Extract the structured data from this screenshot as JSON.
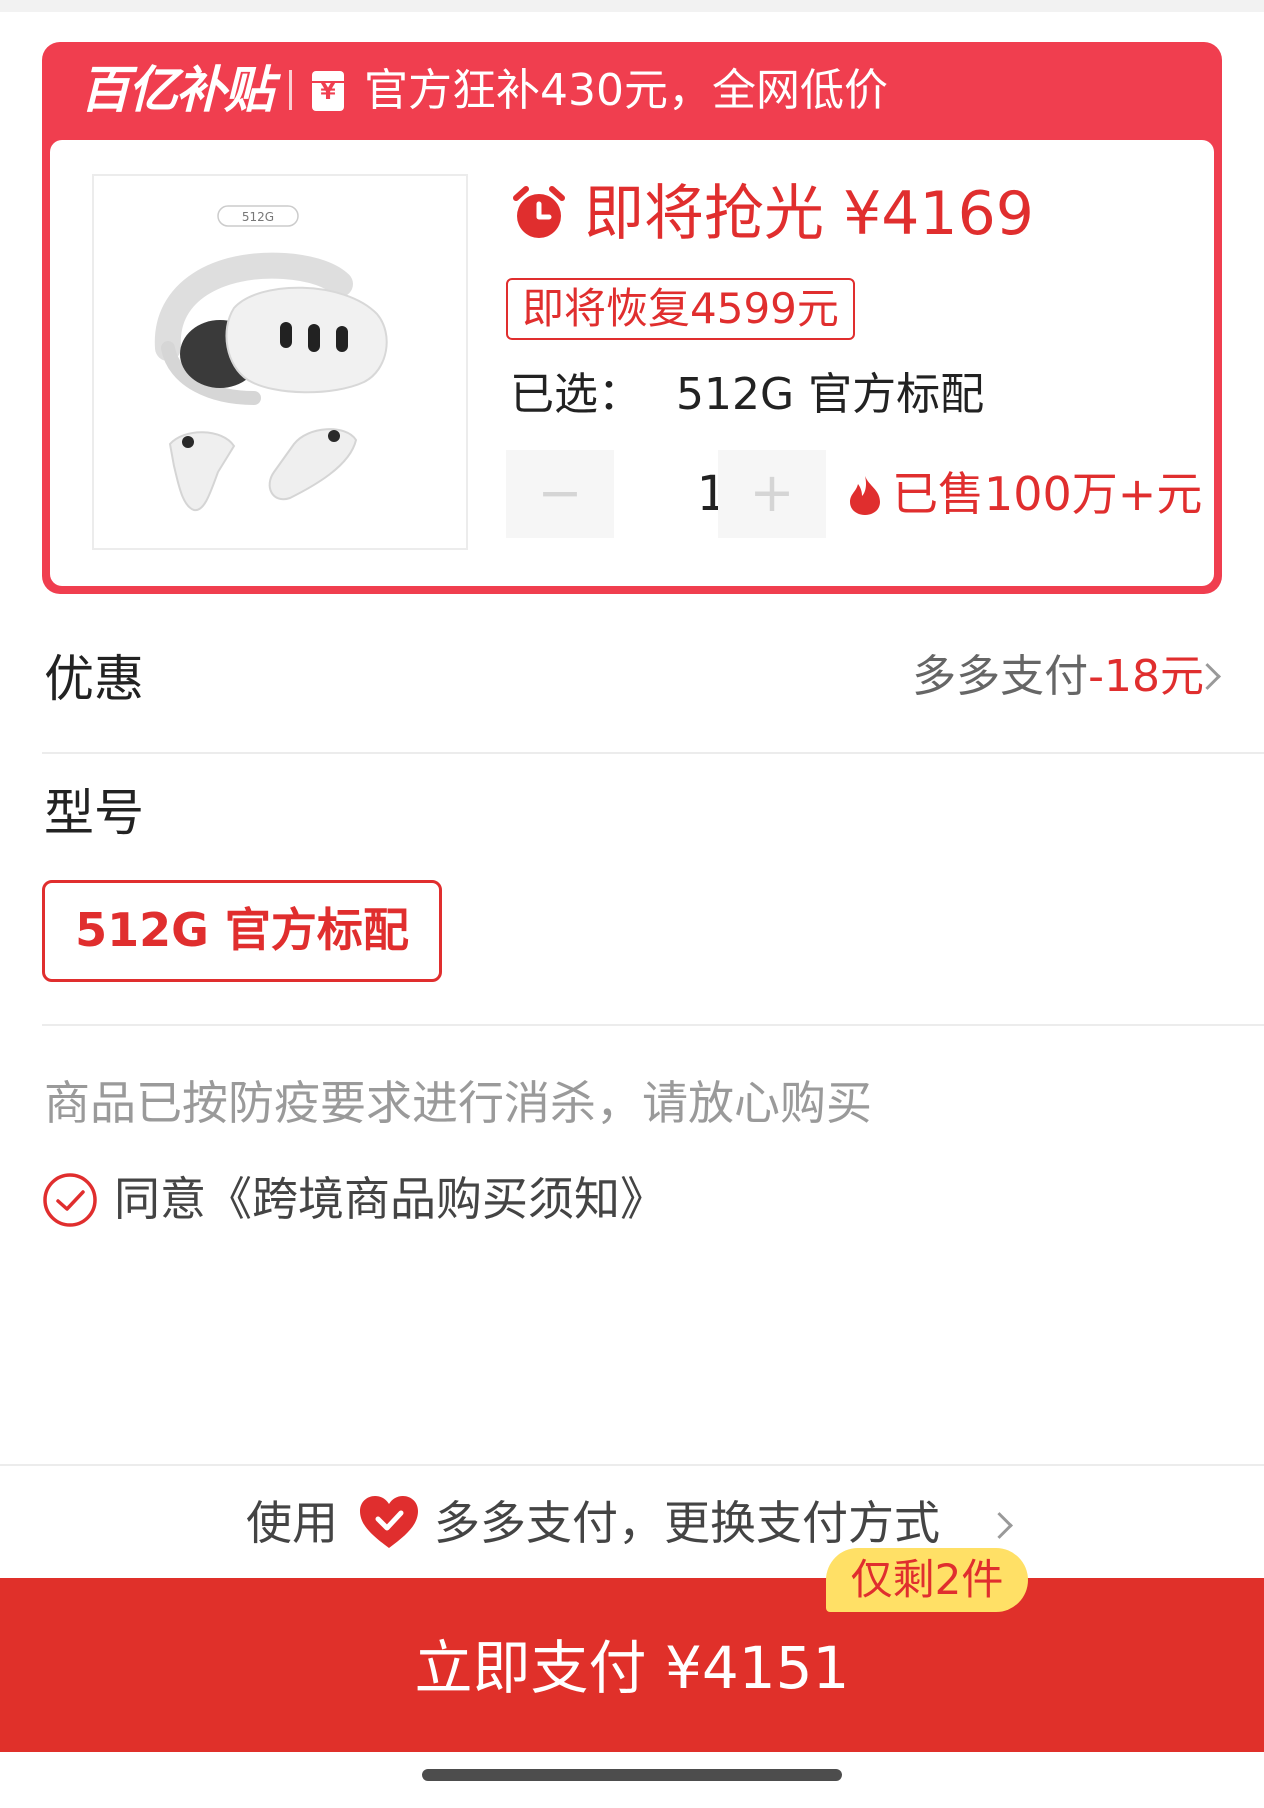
{
  "banner": {
    "brand": "百亿补贴",
    "coupon_icon_glyph": "¥",
    "text": "官方狂补430元，全网低价"
  },
  "product": {
    "image_label": "512G",
    "flash_price_text": "即将抢光 ¥4169",
    "restore_text": "即将恢复4599元",
    "selected_label": "已选：",
    "selected_value": "512G 官方标配",
    "qty_minus": "−",
    "qty_value": "1",
    "qty_plus": "+",
    "sold_text": "已售100万+元"
  },
  "discount": {
    "label": "优惠",
    "method": "多多支付",
    "amount": "-18元"
  },
  "model": {
    "label": "型号",
    "option": "512G 官方标配"
  },
  "notice": "商品已按防疫要求进行消杀，请放心购买",
  "agreement": "同意《跨境商品购买须知》",
  "payment": {
    "prefix": "使用",
    "method_text": "多多支付，更换支付方式",
    "stock_tag": "仅剩2件",
    "button_label": "立即支付 ¥4151"
  },
  "colors": {
    "accent_red": "#e02e2e",
    "banner_red": "#f03e4f",
    "button_red": "#e0302a",
    "stock_yellow": "#ffe066"
  }
}
